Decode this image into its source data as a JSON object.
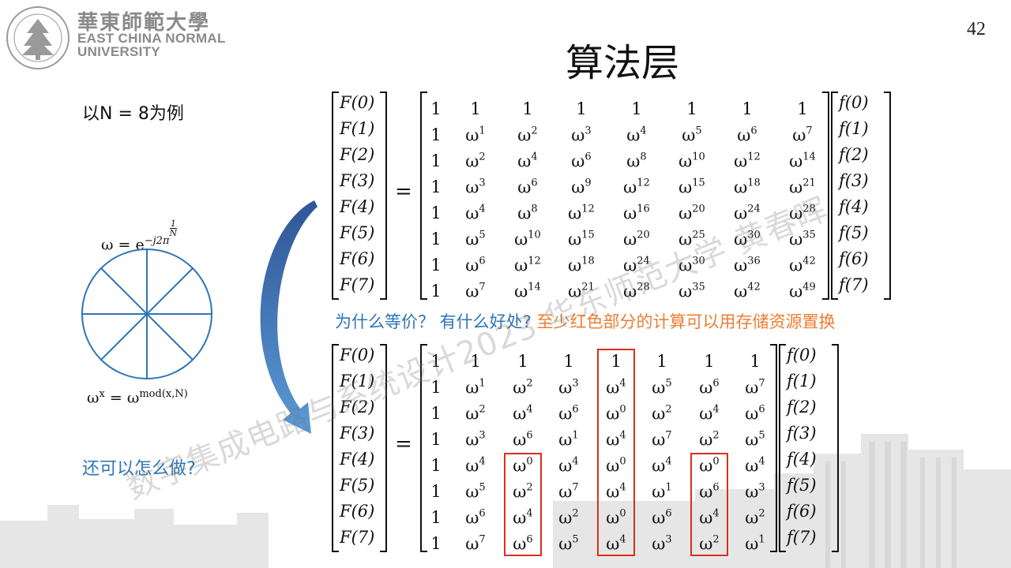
{
  "header": {
    "university_cn": "華東師範大學",
    "university_en_line1": "EAST CHINA NORMAL",
    "university_en_line2": "UNIVERSITY",
    "page_number": "42"
  },
  "title": "算法层",
  "left": {
    "example_label": "以N = 8为例",
    "omega_prefix": "ω = e",
    "omega_exp": "−j2π",
    "omega_frac_num": "1",
    "omega_frac_den": "N",
    "mod_lhs_base": "ω",
    "mod_lhs_exp": "x",
    "mod_eq": " = ω",
    "mod_rhs_exp": "mod(x,N)",
    "question": "还可以怎么做?"
  },
  "question_line": {
    "part1": "为什么等价？  有什么好处?",
    "part2": " 至少红色部分的计算可以用存储资源置换"
  },
  "watermark": "数字集成电路与系统设计2023 华东师范大学 黄春晖",
  "colors": {
    "accent_blue": "#2e75b6",
    "accent_orange": "#ed7d31",
    "highlight_red": "#d9301f"
  },
  "matrix_top": {
    "lhs": [
      "F(0)",
      "F(1)",
      "F(2)",
      "F(3)",
      "F(4)",
      "F(5)",
      "F(6)",
      "F(7)"
    ],
    "rhs": [
      "f(0)",
      "f(1)",
      "f(2)",
      "f(3)",
      "f(4)",
      "f(5)",
      "f(6)",
      "f(7)"
    ],
    "exponents": [
      [
        null,
        null,
        null,
        null,
        null,
        null,
        null,
        null
      ],
      [
        null,
        1,
        2,
        3,
        4,
        5,
        6,
        7
      ],
      [
        null,
        2,
        4,
        6,
        8,
        10,
        12,
        14
      ],
      [
        null,
        3,
        6,
        9,
        12,
        15,
        18,
        21
      ],
      [
        null,
        4,
        8,
        12,
        16,
        20,
        24,
        28
      ],
      [
        null,
        5,
        10,
        15,
        20,
        25,
        30,
        35
      ],
      [
        null,
        6,
        12,
        18,
        24,
        30,
        36,
        42
      ],
      [
        null,
        7,
        14,
        21,
        28,
        35,
        42,
        49
      ]
    ]
  },
  "matrix_bottom": {
    "lhs": [
      "F(0)",
      "F(1)",
      "F(2)",
      "F(3)",
      "F(4)",
      "F(5)",
      "F(6)",
      "F(7)"
    ],
    "rhs": [
      "f(0)",
      "f(1)",
      "f(2)",
      "f(3)",
      "f(4)",
      "f(5)",
      "f(6)",
      "f(7)"
    ],
    "exponents": [
      [
        null,
        null,
        null,
        null,
        null,
        null,
        null,
        null
      ],
      [
        null,
        1,
        2,
        3,
        4,
        5,
        6,
        7
      ],
      [
        null,
        2,
        4,
        6,
        0,
        2,
        4,
        6
      ],
      [
        null,
        3,
        6,
        1,
        4,
        7,
        2,
        5
      ],
      [
        null,
        4,
        0,
        4,
        0,
        4,
        0,
        4
      ],
      [
        null,
        5,
        2,
        7,
        4,
        1,
        6,
        3
      ],
      [
        null,
        6,
        4,
        2,
        0,
        6,
        4,
        2
      ],
      [
        null,
        7,
        6,
        5,
        4,
        3,
        2,
        1
      ]
    ],
    "highlighted": [
      {
        "column": 2,
        "rows": [
          4,
          7
        ]
      },
      {
        "column": 4,
        "rows": [
          0,
          7
        ]
      },
      {
        "column": 6,
        "rows": [
          4,
          7
        ]
      }
    ]
  }
}
